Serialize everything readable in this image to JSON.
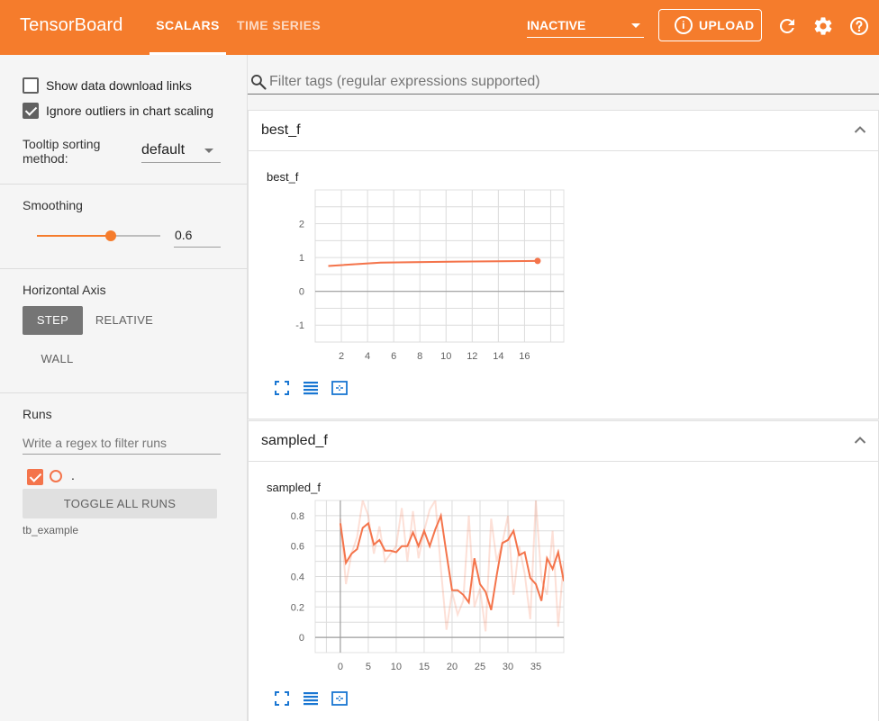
{
  "header": {
    "brand": "TensorBoard",
    "tabs": [
      {
        "label": "SCALARS"
      },
      {
        "label": "TIME SERIES"
      }
    ],
    "run_select": "INACTIVE",
    "upload_label": "UPLOAD",
    "colors": {
      "accent": "#f57c2c"
    }
  },
  "sidebar": {
    "show_download_links": "Show data download links",
    "ignore_outliers": "Ignore outliers in chart scaling",
    "tooltip_sorting_label": "Tooltip sorting method:",
    "tooltip_sorting_value": "default",
    "smoothing_label": "Smoothing",
    "smoothing_value": "0.6",
    "smoothing_fraction": 0.6,
    "horizontal_axis_label": "Horizontal Axis",
    "axis_options": [
      "STEP",
      "RELATIVE",
      "WALL"
    ],
    "axis_selected": "STEP",
    "runs_label": "Runs",
    "runs_filter_placeholder": "Write a regex to filter runs",
    "run_name": ".",
    "toggle_all": "TOGGLE ALL RUNS",
    "log_dir": "tb_example"
  },
  "main": {
    "filter_placeholder": "Filter tags (regular expressions supported)",
    "cards": [
      {
        "tag": "best_f",
        "chart_title": "best_f"
      },
      {
        "tag": "sampled_f",
        "chart_title": "sampled_f"
      }
    ]
  },
  "chart_data": [
    {
      "type": "line",
      "title": "best_f",
      "xlabel": "",
      "ylabel": "",
      "xlim": [
        0,
        19
      ],
      "ylim": [
        -1.5,
        3.0
      ],
      "xticks": [
        2,
        4,
        6,
        8,
        10,
        12,
        14,
        16
      ],
      "yticks": [
        -1,
        0,
        1,
        2
      ],
      "grid": true,
      "color": "#f4744b",
      "series": [
        {
          "x": [
            1,
            5,
            11,
            17
          ],
          "raw": [
            0.75,
            0.85,
            0.88,
            0.9
          ],
          "smoothed": [
            0.75,
            0.85,
            0.88,
            0.9
          ]
        }
      ]
    },
    {
      "type": "line",
      "title": "sampled_f",
      "xlabel": "",
      "ylabel": "",
      "xlim": [
        -4.5,
        40
      ],
      "ylim": [
        -0.1,
        0.9
      ],
      "xticks": [
        0,
        5,
        10,
        15,
        20,
        25,
        30,
        35
      ],
      "yticks": [
        0,
        0.2,
        0.4,
        0.6,
        0.8
      ],
      "grid": true,
      "color": "#f4744b",
      "series": [
        {
          "x": [
            0,
            1,
            2,
            3,
            4,
            5,
            6,
            7,
            8,
            9,
            10,
            11,
            12,
            13,
            14,
            15,
            16,
            17,
            18,
            19,
            20,
            21,
            22,
            23,
            24,
            25,
            26,
            27,
            28,
            29,
            30,
            31,
            32,
            33,
            34,
            35,
            36,
            37,
            38,
            39,
            40
          ],
          "raw": [
            0.78,
            0.35,
            0.55,
            0.66,
            0.9,
            0.8,
            0.55,
            0.73,
            0.5,
            0.55,
            0.6,
            0.85,
            0.5,
            0.83,
            0.52,
            0.7,
            0.84,
            0.9,
            0.45,
            0.05,
            0.3,
            0.15,
            0.24,
            0.8,
            0.2,
            0.32,
            0.04,
            0.78,
            0.5,
            0.62,
            0.8,
            0.28,
            0.6,
            0.42,
            0.12,
            0.9,
            0.38,
            0.28,
            0.7,
            0.07,
            0.5
          ],
          "smoothed": [
            0.75,
            0.49,
            0.55,
            0.58,
            0.72,
            0.75,
            0.61,
            0.64,
            0.57,
            0.57,
            0.56,
            0.6,
            0.6,
            0.69,
            0.6,
            0.7,
            0.6,
            0.71,
            0.8,
            0.55,
            0.31,
            0.31,
            0.28,
            0.23,
            0.52,
            0.35,
            0.3,
            0.18,
            0.41,
            0.62,
            0.64,
            0.7,
            0.54,
            0.56,
            0.39,
            0.35,
            0.24,
            0.52,
            0.45,
            0.56,
            0.37
          ]
        }
      ]
    }
  ]
}
